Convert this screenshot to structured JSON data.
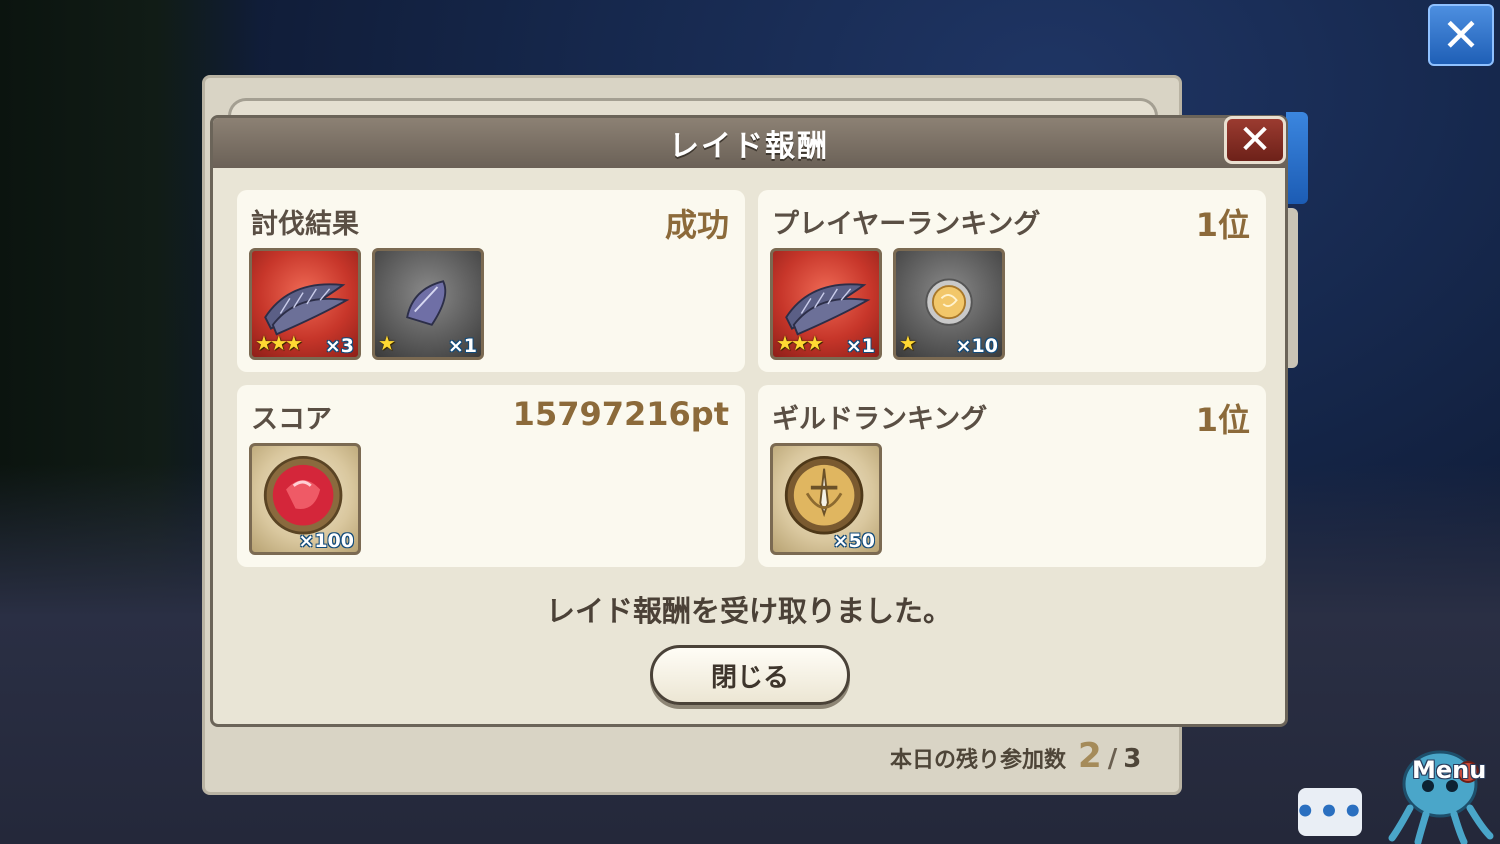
{
  "dialog": {
    "title": "レイド報酬",
    "close_glyph": "✕",
    "message": "レイド報酬を受け取りました。",
    "close_button_label": "閉じる"
  },
  "cards": {
    "result": {
      "title": "討伐結果",
      "value": "成功",
      "items": [
        {
          "icon": "purple-feather-bundle-icon",
          "bg": "red",
          "stars": "★★★",
          "qty": "×3"
        },
        {
          "icon": "purple-feather-icon",
          "bg": "gray",
          "stars": "★",
          "qty": "×1"
        }
      ]
    },
    "player_ranking": {
      "title": "プレイヤーランキング",
      "value": "1位",
      "items": [
        {
          "icon": "purple-feather-bundle-icon",
          "bg": "red",
          "stars": "★★★",
          "qty": "×1"
        },
        {
          "icon": "gold-orb-icon",
          "bg": "gray",
          "stars": "★",
          "qty": "×10"
        }
      ]
    },
    "score": {
      "title": "スコア",
      "value": "15797216pt",
      "items": [
        {
          "icon": "red-gem-coin-icon",
          "bg": "tan",
          "stars": "",
          "qty": "×100"
        }
      ]
    },
    "guild_ranking": {
      "title": "ギルドランキング",
      "value": "1位",
      "items": [
        {
          "icon": "sword-shield-medal-icon",
          "bg": "tan",
          "stars": "",
          "qty": "×50"
        }
      ]
    }
  },
  "remaining": {
    "label": "本日の残り参加数",
    "current": "2",
    "slash": "/",
    "total": "3"
  },
  "hud": {
    "close_glyph": "✕",
    "chat_glyph": "•••",
    "menu_label": "Menu"
  }
}
